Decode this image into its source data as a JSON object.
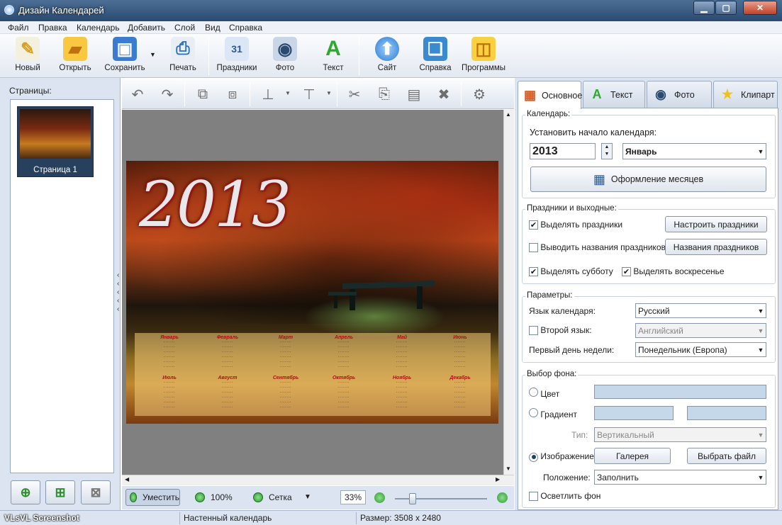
{
  "window": {
    "title": "Дизайн Календарей"
  },
  "menu": [
    "Файл",
    "Правка",
    "Календарь",
    "Добавить",
    "Слой",
    "Вид",
    "Справка"
  ],
  "toolbar": {
    "new": "Новый",
    "open": "Открыть",
    "save": "Сохранить",
    "print": "Печать",
    "holidays": "Праздники",
    "photo": "Фото",
    "text": "Текст",
    "site": "Сайт",
    "help": "Справка",
    "programs": "Программы"
  },
  "left": {
    "pages_label": "Страницы:",
    "page1": "Страница 1"
  },
  "calendar": {
    "year": "2013",
    "months": [
      {
        "name": "Январь"
      },
      {
        "name": "Февраль"
      },
      {
        "name": "Март"
      },
      {
        "name": "Апрель"
      },
      {
        "name": "Май"
      },
      {
        "name": "Июнь"
      },
      {
        "name": "Июль"
      },
      {
        "name": "Август"
      },
      {
        "name": "Сентябрь"
      },
      {
        "name": "Октябрь"
      },
      {
        "name": "Ноябрь"
      },
      {
        "name": "Декабрь"
      }
    ]
  },
  "zoombar": {
    "fit": "Уместить",
    "hundred": "100%",
    "grid": "Сетка",
    "zoom_value": "33%"
  },
  "tabs": {
    "basic": "Основное",
    "text": "Текст",
    "photo": "Фото",
    "clipart": "Клипарт"
  },
  "calendar_group": {
    "title": "Календарь:",
    "start_label": "Установить начало календаря:",
    "year_value": "2013",
    "month_value": "Январь",
    "months_design_button": "Оформление месяцев"
  },
  "holidays_group": {
    "title": "Праздники и выходные:",
    "highlight_holidays": "Выделять праздники",
    "show_holiday_names": "Выводить названия праздников",
    "highlight_saturday": "Выделять субботу",
    "highlight_sunday": "Выделять воскресенье",
    "setup_holidays_button": "Настроить праздники",
    "holiday_names_button": "Названия праздников"
  },
  "params_group": {
    "title": "Параметры:",
    "language_label": "Язык календаря:",
    "language_value": "Русский",
    "second_language_label": "Второй язык:",
    "second_language_value": "Английский",
    "first_day_label": "Первый день недели:",
    "first_day_value": "Понедельник (Европа)"
  },
  "background_group": {
    "title": "Выбор фона:",
    "color_label": "Цвет",
    "gradient_label": "Градиент",
    "type_label": "Тип:",
    "type_value": "Вертикальный",
    "image_label": "Изображение",
    "gallery_button": "Галерея",
    "choose_file_button": "Выбрать файл",
    "position_label": "Положение:",
    "position_value": "Заполнить",
    "lighten_label": "Осветлить фон"
  },
  "status": {
    "watermark": "VLsVL Screenshot",
    "type": "Настенный календарь",
    "size": "Размер: 3508 x 2480"
  },
  "colors": {
    "accent_red": "#b01010",
    "swatch": "#c4d8ea"
  }
}
